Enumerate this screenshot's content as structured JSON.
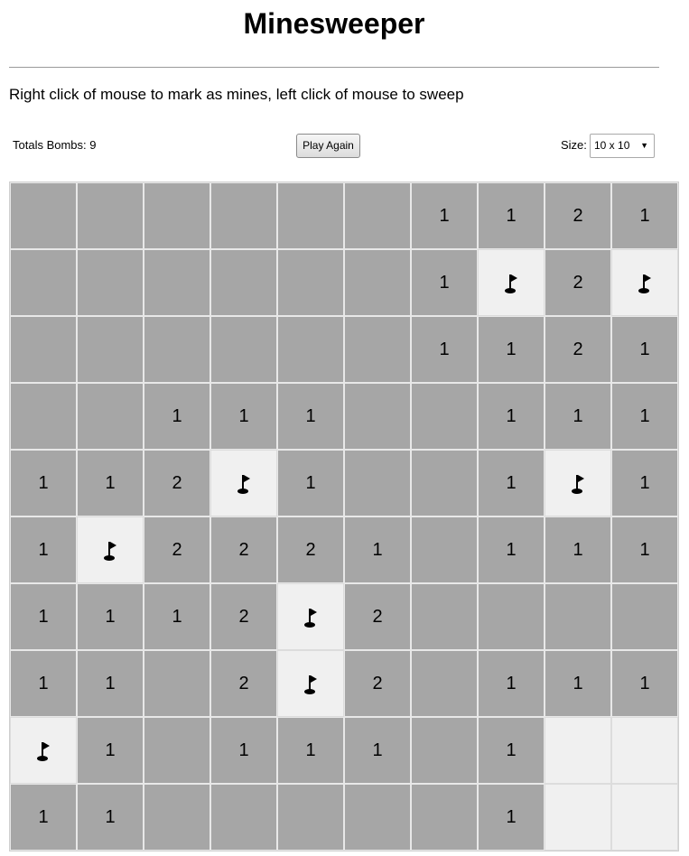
{
  "title": "Minesweeper",
  "instructions": "Right click of mouse to mark as mines, left click of mouse to sweep",
  "controls": {
    "bombs_label": "Totals Bombs: 9",
    "play_again_label": "Play Again",
    "size_label": "Size:",
    "size_selected": "10 x 10"
  },
  "board": {
    "rows": 10,
    "cols": 10,
    "legend": {
      "F": "flag-icon",
      "H": "unrevealed",
      "": "revealed-empty"
    },
    "cells": [
      [
        "",
        "",
        "",
        "",
        "",
        "",
        "1",
        "1",
        "2",
        "1"
      ],
      [
        "",
        "",
        "",
        "",
        "",
        "",
        "1",
        "F",
        "2",
        "F"
      ],
      [
        "",
        "",
        "",
        "",
        "",
        "",
        "1",
        "1",
        "2",
        "1"
      ],
      [
        "",
        "",
        "1",
        "1",
        "1",
        "",
        "",
        "1",
        "1",
        "1"
      ],
      [
        "1",
        "1",
        "2",
        "F",
        "1",
        "",
        "",
        "1",
        "F",
        "1"
      ],
      [
        "1",
        "F",
        "2",
        "2",
        "2",
        "1",
        "",
        "1",
        "1",
        "1"
      ],
      [
        "1",
        "1",
        "1",
        "2",
        "F",
        "2",
        "",
        "",
        "",
        ""
      ],
      [
        "1",
        "1",
        "",
        "2",
        "F",
        "2",
        "",
        "1",
        "1",
        "1"
      ],
      [
        "F",
        "1",
        "",
        "1",
        "1",
        "1",
        "",
        "1",
        "H",
        "H"
      ],
      [
        "1",
        "1",
        "",
        "",
        "",
        "",
        "",
        "1",
        "H",
        "H"
      ]
    ]
  }
}
